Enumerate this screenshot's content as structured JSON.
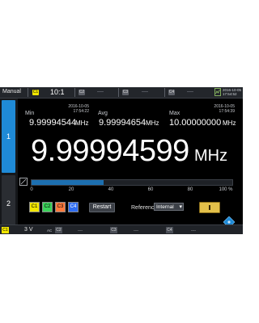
{
  "topbar": {
    "mode": "Manual",
    "ch1": "C1",
    "ratio": "10:1",
    "ch2": "C2",
    "ch3": "C3",
    "ch4": "C4",
    "dashes": "----",
    "datetime_date": "2016-10-05",
    "datetime_time": "17:54:52"
  },
  "tabs": {
    "tab1": "1",
    "tab2": "2"
  },
  "measurements": {
    "min": {
      "label": "Min",
      "date": "2016-10-05",
      "time": "17:54:22",
      "value": "9.99994544",
      "unit": "MHz"
    },
    "avg": {
      "label": "Avg",
      "value": "9.99994654",
      "unit": "MHz"
    },
    "max": {
      "label": "Max",
      "date": "2016-10-05",
      "time": "17:54:39",
      "value": "10.00000000",
      "unit": "MHz"
    },
    "current": {
      "value": "9.99994599",
      "unit": "MHz"
    }
  },
  "progress": {
    "fraction": 0.36,
    "ticks": [
      "0",
      "20",
      "40",
      "60",
      "80",
      "100 %"
    ]
  },
  "controls": {
    "channels": [
      {
        "label": "C1",
        "color": "#f2e600"
      },
      {
        "label": "C2",
        "color": "#3bd25a"
      },
      {
        "label": "C3",
        "color": "#ff7a3d"
      },
      {
        "label": "C4",
        "color": "#2f6df0"
      }
    ],
    "restart": "Restart",
    "reference_label": "Reference",
    "reference_value": "Internal"
  },
  "channel_bar": {
    "c1": "C1",
    "c1_value": "3 V",
    "c1_coupling": "AC",
    "c2": "C2",
    "c3": "C3",
    "c4": "C4",
    "dashes": "----"
  },
  "colors": {
    "accent": "#1f8ad6",
    "ch1": "#f2e600",
    "pause": "#e3c04a"
  }
}
